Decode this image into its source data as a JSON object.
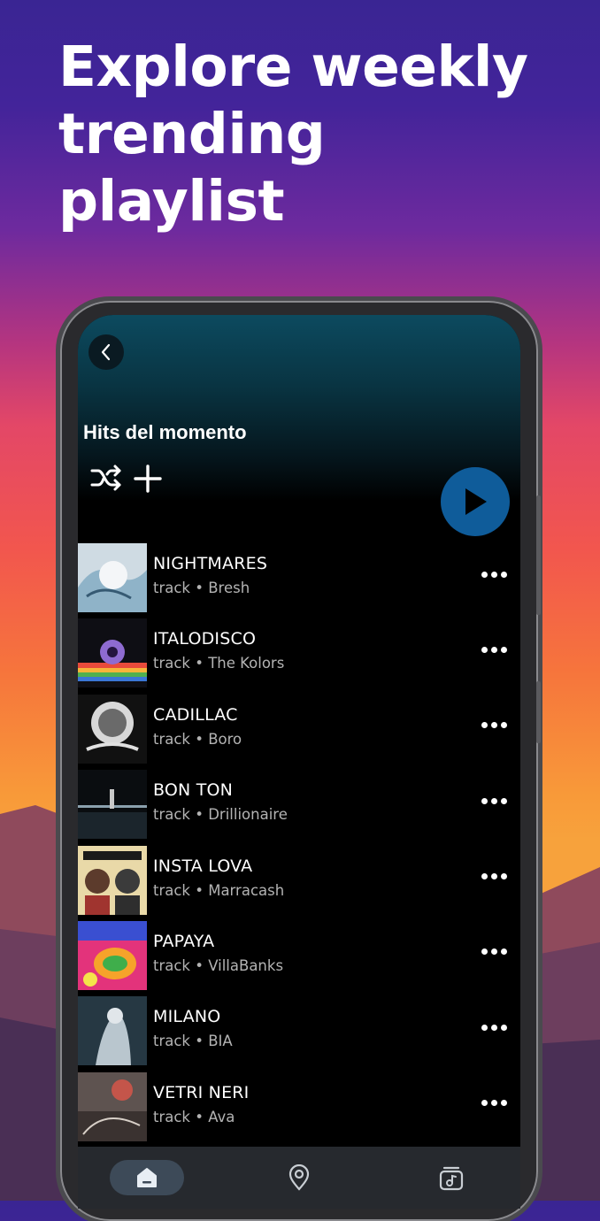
{
  "headline": "Explore weekly trending playlist",
  "playlist": {
    "title": "Hits del momento"
  },
  "tracks": [
    {
      "title": "NIGHTMARES",
      "subtitle": "track • Bresh"
    },
    {
      "title": "ITALODISCO",
      "subtitle": "track • The Kolors"
    },
    {
      "title": "CADILLAC",
      "subtitle": "track • Boro"
    },
    {
      "title": "BON TON",
      "subtitle": "track • Drillionaire"
    },
    {
      "title": "INSTA LOVA",
      "subtitle": "track • Marracash"
    },
    {
      "title": "PAPAYA",
      "subtitle": "track • VillaBanks"
    },
    {
      "title": "MILANO",
      "subtitle": "track • BIA"
    },
    {
      "title": "VETRI NERI",
      "subtitle": "track • Ava"
    }
  ],
  "icons": {
    "back": "chevron-left-icon",
    "shuffle": "shuffle-icon",
    "add": "plus-icon",
    "play": "play-icon",
    "more": "more-horizontal-icon",
    "nav_home": "home-icon",
    "nav_explore": "location-pin-icon",
    "nav_library": "music-library-icon"
  },
  "colors": {
    "play_button": "#0f5c9a",
    "nav_background": "#26292e",
    "nav_active_pill": "#3d4a58",
    "header_teal": "#0c4a5f"
  }
}
